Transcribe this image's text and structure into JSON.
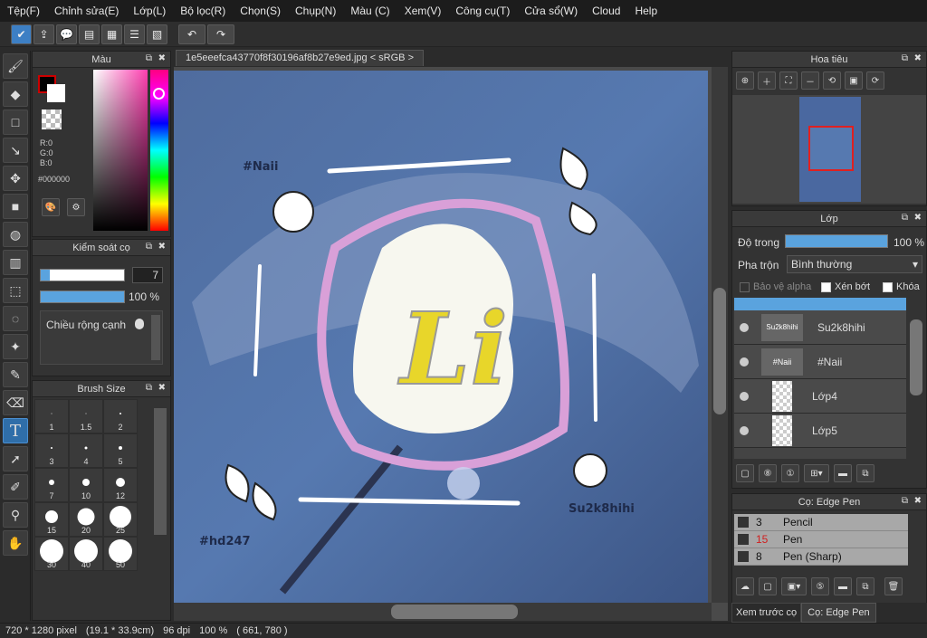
{
  "menubar": {
    "items": [
      "Tệp(F)",
      "Chỉnh sửa(E)",
      "Lớp(L)",
      "Bộ lọc(R)",
      "Chọn(S)",
      "Chụp(N)",
      "Màu (C)",
      "Xem(V)",
      "Công cụ(T)",
      "Cửa sổ(W)",
      "Cloud",
      "Help"
    ]
  },
  "toolbar": {
    "undo_icon": "undo-icon",
    "redo_icon": "redo-icon"
  },
  "document_tab": {
    "title": "1e5eeefca43770f8f30196af8b27e9ed.jpg < sRGB >"
  },
  "color_panel": {
    "title": "Màu",
    "r": "R:0",
    "g": "G:0",
    "b": "B:0",
    "hex": "#000000"
  },
  "brush_control": {
    "title": "Kiểm soát cọ",
    "size_value": "7",
    "opacity_value": "100 %",
    "width_label": "Chiều rộng cạnh"
  },
  "brush_size": {
    "title": "Brush Size",
    "sizes": [
      "1",
      "1.5",
      "2",
      "3",
      "4",
      "5",
      "7",
      "10",
      "12",
      "15",
      "20",
      "25",
      "30",
      "40",
      "50"
    ]
  },
  "navigator": {
    "title": "Hoa tiêu"
  },
  "layers": {
    "title": "Lớp",
    "opacity_label": "Độ trong",
    "opacity_value": "100 %",
    "opacity_fraction": 1.0,
    "blend_label": "Pha trộn",
    "blend_value": "Bình thường",
    "protect_alpha": "Bảo vệ alpha",
    "clipping": "Xén bớt",
    "lock": "Khóa",
    "items": [
      {
        "name": "Su2k8hihi",
        "thumb": "Su2k8hihi"
      },
      {
        "name": "#Naii",
        "thumb": "#Naii"
      },
      {
        "name": "Lớp4",
        "thumb": ""
      },
      {
        "name": "Lớp5",
        "thumb": ""
      }
    ]
  },
  "brush_panel": {
    "title": "Cọ: Edge Pen",
    "items": [
      {
        "size": "3",
        "name": "Pencil"
      },
      {
        "size": "15",
        "name": "Pen"
      },
      {
        "size": "8",
        "name": "Pen (Sharp)"
      }
    ]
  },
  "bottom_tabs": {
    "preview": "Xem trước cọ",
    "edge": "Cọ: Edge Pen"
  },
  "statusbar": {
    "size": "720 * 1280 pixel",
    "cm": "(19.1 * 33.9cm)",
    "dpi": "96 dpi",
    "zoom": "100 %",
    "coords": "( 661, 780 )"
  },
  "artwork": {
    "text_naii": "#Naii",
    "text_su": "Su2k8hihi",
    "text_hd": "#hd247",
    "letters": "Li"
  }
}
